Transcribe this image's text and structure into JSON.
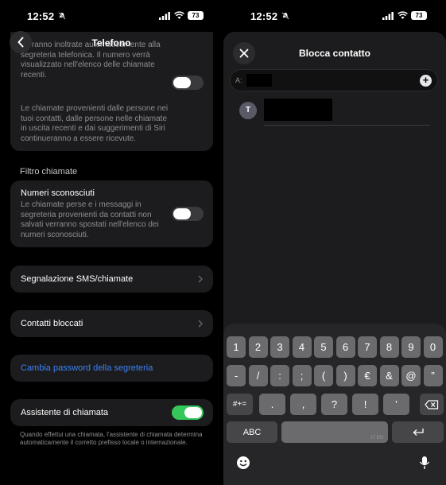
{
  "status": {
    "time": "12:52",
    "battery": "73"
  },
  "left": {
    "nav_title": "Telefono",
    "top_card_text": "verranno inoltrate automaticamente alla segreteria telefonica. Il numero verrà visualizzato nell'elenco delle chiamate recenti.",
    "top_card_text2": "Le chiamate provenienti dalle persone nei tuoi contatti, dalle persone nelle chiamate in uscita recenti e dai suggerimenti di Siri continueranno a essere ricevute.",
    "section_filter": "Filtro chiamate",
    "unknown_title": "Numeri sconosciuti",
    "unknown_desc": "Le chiamate perse e i messaggi in segreteria provenienti da contatti non salvati verranno spostati nell'elenco dei numeri sconosciuti.",
    "sms_report": "Segnalazione SMS/chiamate",
    "blocked": "Contatti bloccati",
    "change_pw": "Cambia password della segreteria",
    "assistant": "Assistente di chiamata",
    "assistant_desc": "Quando effettui una chiamata, l'assistente di chiamata determina automaticamente il corretto prefisso locale o internazionale.",
    "toggles": {
      "silence_unknown": false,
      "unknown_numbers": false,
      "dial_assist": true
    },
    "colors": {
      "link": "#3b82f6",
      "toggle_on": "#34c759"
    }
  },
  "right": {
    "sheet_title": "Blocca contatto",
    "to_label": "A:",
    "contact_initial": "T",
    "keyboard": {
      "row1": [
        "1",
        "2",
        "3",
        "4",
        "5",
        "6",
        "7",
        "8",
        "9",
        "0"
      ],
      "row2": [
        "-",
        "/",
        ":",
        ";",
        "(",
        ")",
        "€",
        "&",
        "@",
        "”"
      ],
      "row3": [
        "#+=",
        ".",
        ",",
        "?",
        "!",
        "’"
      ],
      "abc": "ABC",
      "space_hint": "IT EN"
    }
  }
}
